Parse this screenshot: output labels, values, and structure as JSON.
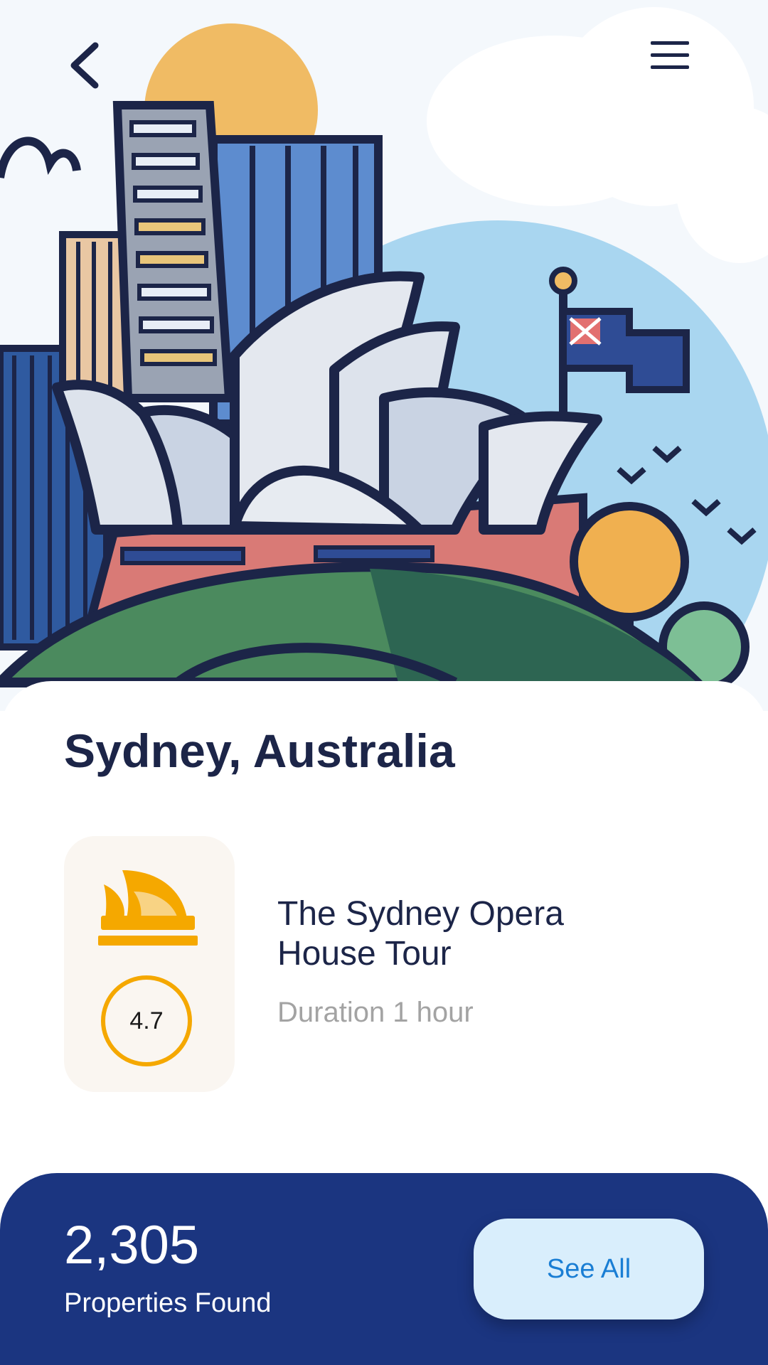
{
  "hero": {
    "illustration": "sydney-opera-house-illustration",
    "back_icon": "chevron-left-icon",
    "menu_icon": "hamburger-menu-icon"
  },
  "city": {
    "title": "Sydney, Australia"
  },
  "tour": {
    "title": "The Sydney Opera House Tour",
    "duration": "Duration 1 hour",
    "rating": "4.7",
    "icon": "opera-house-icon"
  },
  "results": {
    "count": "2,305",
    "label": "Properties Found",
    "button_label": "See All"
  },
  "colors": {
    "primary_dark": "#1c2548",
    "footer_bg": "#1b3580",
    "accent": "#f5a800",
    "button_bg": "#d9eefc",
    "button_text": "#1a7ed4"
  }
}
